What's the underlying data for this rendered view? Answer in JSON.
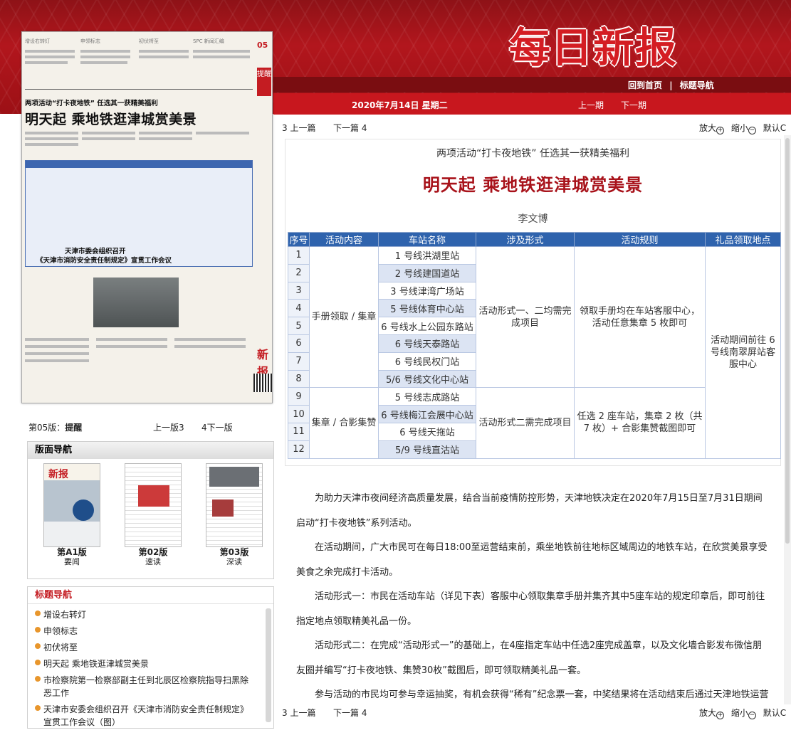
{
  "header": {
    "logo": "每日新报",
    "nav_home": "回到首页",
    "nav_sep": "|",
    "nav_titles": "标题导航",
    "date": "2020年7月14日 星期二",
    "prev_issue": "上一期",
    "next_issue": "下一期"
  },
  "thumbnail": {
    "section_labels": [
      "增设右转灯",
      "申领标志",
      "初伏将至",
      "SPC 新闻汇编"
    ],
    "page_number": "05",
    "tixing": "提醒",
    "kicker": "两项活动“打卡夜地铁” 任选其一获精美福利",
    "headline": "明天起 乘地铁逛津城赏美景",
    "sub_head1": "天津市委会组织召开",
    "sub_head2": "《天津市消防安全责任制规定》宣贯工作会议",
    "brand_mark": "新报"
  },
  "pagebar": {
    "page_label": "第05版：",
    "page_name": "提醒",
    "prev": "上一版3",
    "next": "4下一版"
  },
  "layout_nav": {
    "title": "版面导航",
    "pages": [
      {
        "label": "第A1版",
        "sub": "要闻"
      },
      {
        "label": "第02版",
        "sub": "速读"
      },
      {
        "label": "第03版",
        "sub": "深读"
      }
    ]
  },
  "title_nav": {
    "title": "标题导航",
    "items": [
      "增设右转灯",
      "申领标志",
      "初伏将至",
      "明天起 乘地铁逛津城赏美景",
      "市检察院第一检察部副主任到北辰区检察院指导扫黑除恶工作",
      "天津市安委会组织召开《天津市消防安全责任制规定》宣贯工作会议（图）"
    ]
  },
  "toolbar": {
    "prev_article": "3 上一篇",
    "next_article": "下一篇 4",
    "zoom_in": "放大",
    "zoom_out": "缩小",
    "default": "默认",
    "plus": "+",
    "minus": "−",
    "c": "C"
  },
  "article": {
    "kicker": "两项活动“打卡夜地铁”  任选其一获精美福利",
    "headline": "明天起  乘地铁逛津城赏美景",
    "author": "李文博",
    "table": {
      "headers": [
        "序号",
        "活动内容",
        "车站名称",
        "涉及形式",
        "活动规则",
        "礼品领取地点"
      ],
      "seqs": [
        "1",
        "2",
        "3",
        "4",
        "5",
        "6",
        "7",
        "8",
        "9",
        "10",
        "11",
        "12"
      ],
      "stations": [
        "1 号线洪湖里站",
        "2 号线建国道站",
        "3 号线津湾广场站",
        "5 号线体育中心站",
        "6 号线水上公园东路站",
        "6 号线天泰路站",
        "6 号线民权门站",
        "5/6 号线文化中心站",
        "5 号线志成路站",
        "6 号线梅江会展中心站",
        "6 号线天拖站",
        "5/9 号线直沽站"
      ],
      "content_a": "手册领取 / 集章",
      "content_b": "集章 / 合影集赞",
      "form_a": "活动形式一、二均需完成项目",
      "form_b": "活动形式二需完成项目",
      "rule_a": "领取手册均在车站客服中心，活动任意集章 5 枚即可",
      "rule_b": "任选 2 座车站，集章 2 枚（共 7 枚）+ 合影集赞截图即可",
      "gift": "活动期间前往 6 号线南翠屏站客服中心"
    },
    "paragraphs": [
      "为助力天津市夜间经济高质量发展，结合当前疫情防控形势，天津地铁决定在2020年7月15日至7月31日期间启动“打卡夜地铁”系列活动。",
      "在活动期间，广大市民可在每日18:00至运营结束前，乘坐地铁前往地标区域周边的地铁车站，在欣赏美景享受美食之余完成打卡活动。",
      "活动形式一：市民在活动车站（详见下表）客服中心领取集章手册并集齐其中5座车站的规定印章后，即可前往指定地点领取精美礼品一份。",
      "活动形式二：在完成“活动形式一”的基础上，在4座指定车站中任选2座完成盖章，以及文化墙合影发布微信朋友圈并编写“打卡夜地铁、集赞30枚”截图后，即可领取精美礼品一套。",
      "参与活动的市民均可参与幸运抽奖，有机会获得“稀有”纪念票一套，中奖结果将在活动结束后通过天津地铁运营官方微博平台公布。"
    ]
  },
  "colors": {
    "brand_red": "#c8171e",
    "table_header": "#2f63ad",
    "headline_red": "#a8121a",
    "bullet": "#e8962c"
  }
}
